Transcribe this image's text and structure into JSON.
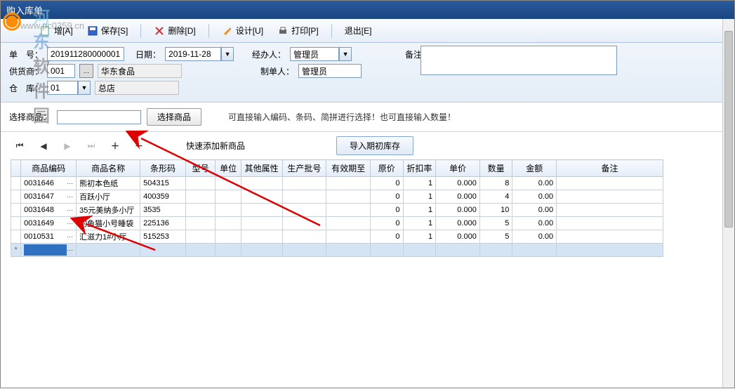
{
  "titlebar": {
    "title": "购入库单"
  },
  "watermark": {
    "logo": "⬢",
    "text1": "河",
    "text2": "东",
    "text3": "软件",
    "text4": "园",
    "url": "www.pc0359.cn"
  },
  "toolbar": {
    "new": "增[A]",
    "save": "保存[S]",
    "delete": "删除[D]",
    "design": "设计[U]",
    "print": "打印[P]",
    "exit": "退出[E]"
  },
  "form": {
    "bill_no_label": "单　号：",
    "bill_no": "201911280000001",
    "date_label": "日期：",
    "date": "2019-11-28",
    "handler_label": "经办人：",
    "handler": "管理员",
    "remark_label": "备注：",
    "supplier_label": "供货商：",
    "supplier_code": "001",
    "supplier_name": "华东食品",
    "maker_label": "制单人：",
    "maker": "管理员",
    "warehouse_label": "仓　库：",
    "warehouse_code": "01",
    "warehouse_name": "总店"
  },
  "select_area": {
    "label": "选择商品：",
    "button": "选择商品",
    "hint": "可直接输入编码、条码、简拼进行选择！也可直接输入数量！"
  },
  "nav": {
    "quick_add": "快速添加新商品",
    "import": "导入期初库存"
  },
  "grid": {
    "headers": [
      "商品编码",
      "商品名称",
      "条形码",
      "型号",
      "单位",
      "其他属性",
      "生产批号",
      "有效期至",
      "原价",
      "折扣率",
      "单价",
      "数量",
      "金额",
      "备注"
    ],
    "rows": [
      {
        "code": "0031646",
        "name": "熊初本色纸",
        "barcode": "504315",
        "model": "",
        "unit": "",
        "attr": "",
        "batch": "",
        "expire": "",
        "orig": "0",
        "disc": "1",
        "price": "0.000",
        "qty": "8",
        "amt": "0.00",
        "remark": ""
      },
      {
        "code": "0031647",
        "name": "百跃小厅",
        "barcode": "400359",
        "model": "",
        "unit": "",
        "attr": "",
        "batch": "",
        "expire": "",
        "orig": "0",
        "disc": "1",
        "price": "0.000",
        "qty": "4",
        "amt": "0.00",
        "remark": ""
      },
      {
        "code": "0031648",
        "name": "35元美纳多小厅",
        "barcode": "3535",
        "model": "",
        "unit": "",
        "attr": "",
        "batch": "",
        "expire": "",
        "orig": "0",
        "disc": "1",
        "price": "0.000",
        "qty": "10",
        "amt": "0.00",
        "remark": ""
      },
      {
        "code": "0031649",
        "name": "钓鱼猫小号睡袋",
        "barcode": "225136",
        "model": "",
        "unit": "",
        "attr": "",
        "batch": "",
        "expire": "",
        "orig": "0",
        "disc": "1",
        "price": "0.000",
        "qty": "5",
        "amt": "0.00",
        "remark": ""
      },
      {
        "code": "0010531",
        "name": "汇滋力1#小厅",
        "barcode": "515253",
        "model": "",
        "unit": "",
        "attr": "",
        "batch": "",
        "expire": "",
        "orig": "0",
        "disc": "1",
        "price": "0.000",
        "qty": "5",
        "amt": "0.00",
        "remark": ""
      }
    ]
  }
}
